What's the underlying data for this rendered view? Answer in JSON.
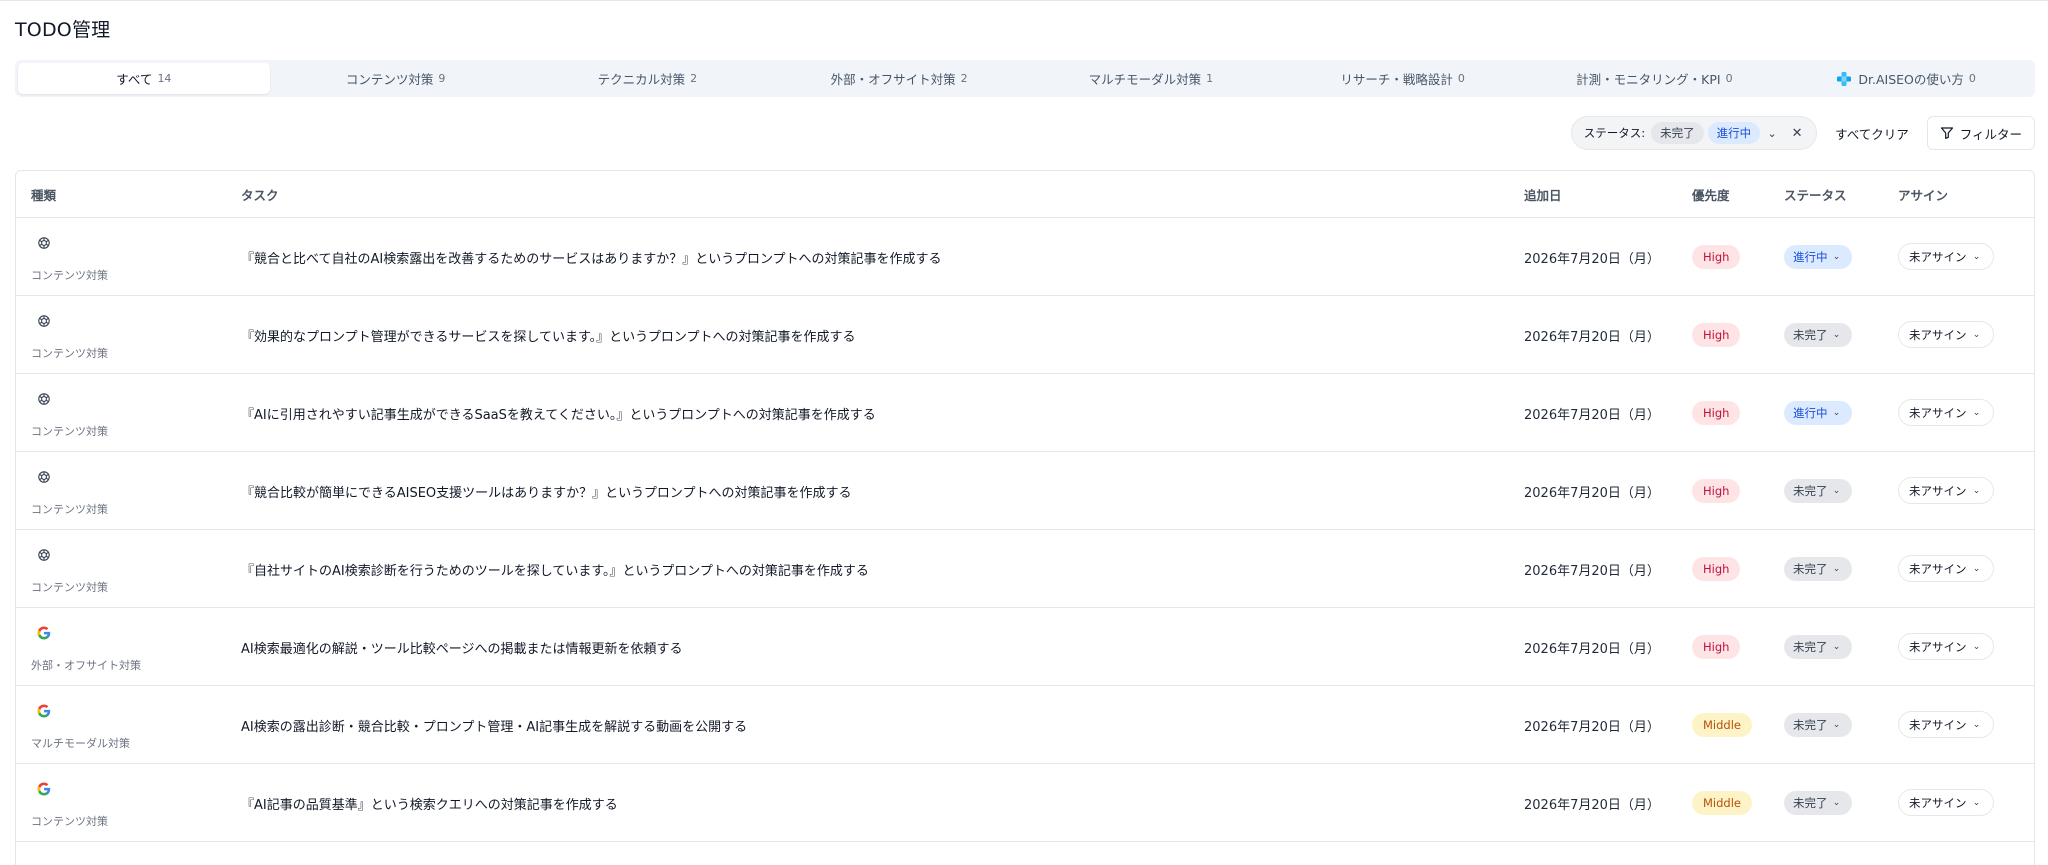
{
  "page": {
    "title": "TODO管理"
  },
  "tabs": [
    {
      "label": "すべて",
      "count": "14",
      "active": true
    },
    {
      "label": "コンテンツ対策",
      "count": "9"
    },
    {
      "label": "テクニカル対策",
      "count": "2"
    },
    {
      "label": "外部・オフサイト対策",
      "count": "2"
    },
    {
      "label": "マルチモーダル対策",
      "count": "1"
    },
    {
      "label": "リサーチ・戦略設計",
      "count": "0"
    },
    {
      "label": "計測・モニタリング・KPI",
      "count": "0"
    },
    {
      "label": "Dr.AISEOの使い方",
      "count": "0",
      "icon": "dr-aiseo-logo-icon"
    }
  ],
  "filters": {
    "status_label": "ステータス:",
    "selected": [
      "未完了",
      "進行中"
    ],
    "clear_all": "すべてクリア",
    "filter_button": "フィルター"
  },
  "table": {
    "headers": {
      "type": "種類",
      "task": "タスク",
      "date": "追加日",
      "priority": "優先度",
      "status": "ステータス",
      "assign": "アサイン"
    },
    "rows": [
      {
        "icon": "openai-icon",
        "type": "コンテンツ対策",
        "task": "『競合と比べて自社のAI検索露出を改善するためのサービスはありますか？』というプロンプトへの対策記事を作成する",
        "date": "2026年7月20日（月）",
        "priority": "High",
        "status": "進行中",
        "assign": "未アサイン"
      },
      {
        "icon": "openai-icon",
        "type": "コンテンツ対策",
        "task": "『効果的なプロンプト管理ができるサービスを探しています。』というプロンプトへの対策記事を作成する",
        "date": "2026年7月20日（月）",
        "priority": "High",
        "status": "未完了",
        "assign": "未アサイン"
      },
      {
        "icon": "openai-icon",
        "type": "コンテンツ対策",
        "task": "『AIに引用されやすい記事生成ができるSaaSを教えてください。』というプロンプトへの対策記事を作成する",
        "date": "2026年7月20日（月）",
        "priority": "High",
        "status": "進行中",
        "assign": "未アサイン"
      },
      {
        "icon": "openai-icon",
        "type": "コンテンツ対策",
        "task": "『競合比較が簡単にできるAISEO支援ツールはありますか？』というプロンプトへの対策記事を作成する",
        "date": "2026年7月20日（月）",
        "priority": "High",
        "status": "未完了",
        "assign": "未アサイン"
      },
      {
        "icon": "openai-icon",
        "type": "コンテンツ対策",
        "task": "『自社サイトのAI検索診断を行うためのツールを探しています。』というプロンプトへの対策記事を作成する",
        "date": "2026年7月20日（月）",
        "priority": "High",
        "status": "未完了",
        "assign": "未アサイン"
      },
      {
        "icon": "google-icon",
        "type": "外部・オフサイト対策",
        "task": "AI検索最適化の解説・ツール比較ページへの掲載または情報更新を依頼する",
        "date": "2026年7月20日（月）",
        "priority": "High",
        "status": "未完了",
        "assign": "未アサイン"
      },
      {
        "icon": "google-icon",
        "type": "マルチモーダル対策",
        "task": "AI検索の露出診断・競合比較・プロンプト管理・AI記事生成を解説する動画を公開する",
        "date": "2026年7月20日（月）",
        "priority": "Middle",
        "status": "未完了",
        "assign": "未アサイン"
      },
      {
        "icon": "google-icon",
        "type": "コンテンツ対策",
        "task": "『AI記事の品質基準』という検索クエリへの対策記事を作成する",
        "date": "2026年7月20日（月）",
        "priority": "Middle",
        "status": "未完了",
        "assign": "未アサイン"
      }
    ]
  }
}
